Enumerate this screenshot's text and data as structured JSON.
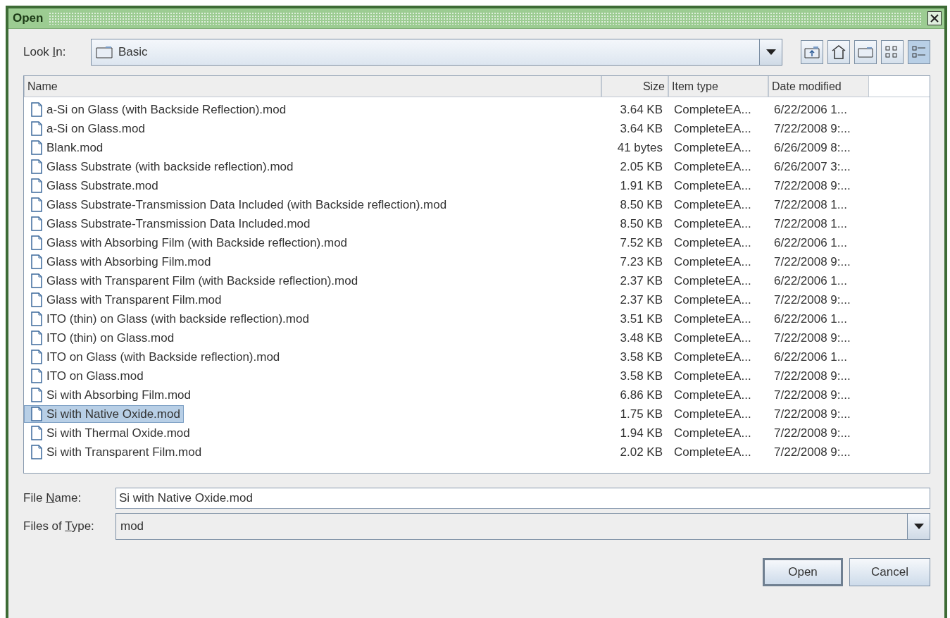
{
  "window": {
    "title": "Open"
  },
  "look_in": {
    "label": {
      "before": "Look ",
      "key": "I",
      "after": "n:"
    },
    "value": "Basic"
  },
  "toolbar": [
    {
      "kind": "up",
      "selected": false
    },
    {
      "kind": "home",
      "selected": false
    },
    {
      "kind": "new_folder",
      "selected": false
    },
    {
      "kind": "list_view",
      "selected": false
    },
    {
      "kind": "details_view",
      "selected": true
    }
  ],
  "table": {
    "columns": [
      "Name",
      "Size",
      "Item type",
      "Date modified"
    ],
    "rows": [
      {
        "name": "a-Si on Glass (with Backside Reflection).mod",
        "size": "3.64 KB",
        "type": "CompleteEA...",
        "date": "6/22/2006 1...",
        "selected": false
      },
      {
        "name": "a-Si on Glass.mod",
        "size": "3.64 KB",
        "type": "CompleteEA...",
        "date": "7/22/2008 9:...",
        "selected": false
      },
      {
        "name": "Blank.mod",
        "size": "41 bytes",
        "type": "CompleteEA...",
        "date": "6/26/2009 8:...",
        "selected": false
      },
      {
        "name": "Glass Substrate (with backside reflection).mod",
        "size": "2.05 KB",
        "type": "CompleteEA...",
        "date": "6/26/2007 3:...",
        "selected": false
      },
      {
        "name": "Glass Substrate.mod",
        "size": "1.91 KB",
        "type": "CompleteEA...",
        "date": "7/22/2008 9:...",
        "selected": false
      },
      {
        "name": "Glass Substrate-Transmission Data Included (with Backside reflection).mod",
        "size": "8.50 KB",
        "type": "CompleteEA...",
        "date": "7/22/2008 1...",
        "selected": false
      },
      {
        "name": "Glass Substrate-Transmission Data Included.mod",
        "size": "8.50 KB",
        "type": "CompleteEA...",
        "date": "7/22/2008 1...",
        "selected": false
      },
      {
        "name": "Glass with Absorbing Film (with Backside reflection).mod",
        "size": "7.52 KB",
        "type": "CompleteEA...",
        "date": "6/22/2006 1...",
        "selected": false
      },
      {
        "name": "Glass with Absorbing Film.mod",
        "size": "7.23 KB",
        "type": "CompleteEA...",
        "date": "7/22/2008 9:...",
        "selected": false
      },
      {
        "name": "Glass with Transparent Film (with Backside reflection).mod",
        "size": "2.37 KB",
        "type": "CompleteEA...",
        "date": "6/22/2006 1...",
        "selected": false
      },
      {
        "name": "Glass with Transparent Film.mod",
        "size": "2.37 KB",
        "type": "CompleteEA...",
        "date": "7/22/2008 9:...",
        "selected": false
      },
      {
        "name": "ITO (thin) on Glass (with backside reflection).mod",
        "size": "3.51 KB",
        "type": "CompleteEA...",
        "date": "6/22/2006 1...",
        "selected": false
      },
      {
        "name": "ITO (thin) on Glass.mod",
        "size": "3.48 KB",
        "type": "CompleteEA...",
        "date": "7/22/2008 9:...",
        "selected": false
      },
      {
        "name": "ITO on Glass (with Backside reflection).mod",
        "size": "3.58 KB",
        "type": "CompleteEA...",
        "date": "6/22/2006 1...",
        "selected": false
      },
      {
        "name": "ITO on Glass.mod",
        "size": "3.58 KB",
        "type": "CompleteEA...",
        "date": "7/22/2008 9:...",
        "selected": false
      },
      {
        "name": "Si with Absorbing Film.mod",
        "size": "6.86 KB",
        "type": "CompleteEA...",
        "date": "7/22/2008 9:...",
        "selected": false
      },
      {
        "name": "Si with Native Oxide.mod",
        "size": "1.75 KB",
        "type": "CompleteEA...",
        "date": "7/22/2008 9:...",
        "selected": true
      },
      {
        "name": "Si with Thermal Oxide.mod",
        "size": "1.94 KB",
        "type": "CompleteEA...",
        "date": "7/22/2008 9:...",
        "selected": false
      },
      {
        "name": "Si with Transparent Film.mod",
        "size": "2.02 KB",
        "type": "CompleteEA...",
        "date": "7/22/2008 9:...",
        "selected": false
      }
    ]
  },
  "file_name": {
    "label": {
      "before": "File ",
      "key": "N",
      "after": "ame:"
    },
    "value": "Si with Native Oxide.mod"
  },
  "file_type": {
    "label": {
      "before": "Files of ",
      "key": "T",
      "after": "ype:"
    },
    "value": "mod"
  },
  "buttons": [
    {
      "label": "Open",
      "kind": "default"
    },
    {
      "label": "Cancel",
      "kind": "normal"
    }
  ]
}
